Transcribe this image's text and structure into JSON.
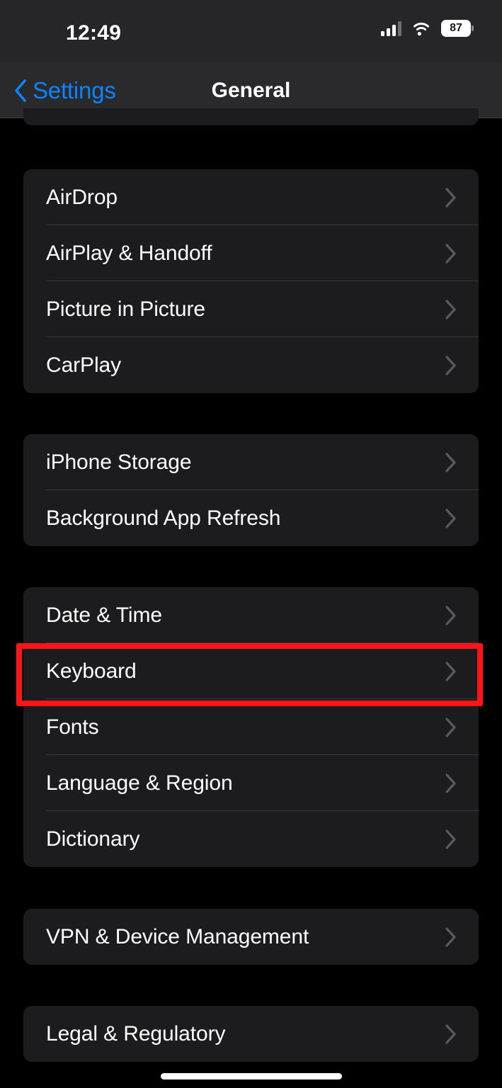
{
  "status_bar": {
    "time": "12:49",
    "battery_percent": "87",
    "signal_icon": "cellular-signal-icon",
    "wifi_icon": "wifi-icon",
    "battery_icon": "battery-icon",
    "signal_bars_filled": 3,
    "signal_bars_total": 4
  },
  "nav_bar": {
    "back_label": "Settings",
    "back_icon": "chevron-left-icon",
    "title": "General"
  },
  "colors": {
    "accent_blue": "#0a84ff",
    "page_background": "#000000",
    "card_background": "#1c1c1e",
    "separator": "#38383a",
    "chevron": "#5a5a5e",
    "annotation_red": "#ff1515",
    "nav_background": "#2a2a2c"
  },
  "annotation": {
    "target_row": "Keyboard",
    "shape": "rectangle",
    "color": "#ff1515"
  },
  "groups": [
    {
      "id": "partial-top-group",
      "partial": true,
      "rows": []
    },
    {
      "id": "sharing-group",
      "rows": [
        {
          "label": "AirDrop",
          "chevron_icon": "chevron-right-icon"
        },
        {
          "label": "AirPlay & Handoff",
          "chevron_icon": "chevron-right-icon"
        },
        {
          "label": "Picture in Picture",
          "chevron_icon": "chevron-right-icon"
        },
        {
          "label": "CarPlay",
          "chevron_icon": "chevron-right-icon"
        }
      ]
    },
    {
      "id": "storage-group",
      "rows": [
        {
          "label": "iPhone Storage",
          "chevron_icon": "chevron-right-icon"
        },
        {
          "label": "Background App Refresh",
          "chevron_icon": "chevron-right-icon"
        }
      ]
    },
    {
      "id": "localization-group",
      "rows": [
        {
          "label": "Date & Time",
          "chevron_icon": "chevron-right-icon"
        },
        {
          "label": "Keyboard",
          "chevron_icon": "chevron-right-icon",
          "highlighted": true
        },
        {
          "label": "Fonts",
          "chevron_icon": "chevron-right-icon"
        },
        {
          "label": "Language & Region",
          "chevron_icon": "chevron-right-icon"
        },
        {
          "label": "Dictionary",
          "chevron_icon": "chevron-right-icon"
        }
      ]
    },
    {
      "id": "vpn-group",
      "rows": [
        {
          "label": "VPN & Device Management",
          "chevron_icon": "chevron-right-icon"
        }
      ]
    },
    {
      "id": "legal-group",
      "rows": [
        {
          "label": "Legal & Regulatory",
          "chevron_icon": "chevron-right-icon"
        }
      ]
    }
  ]
}
